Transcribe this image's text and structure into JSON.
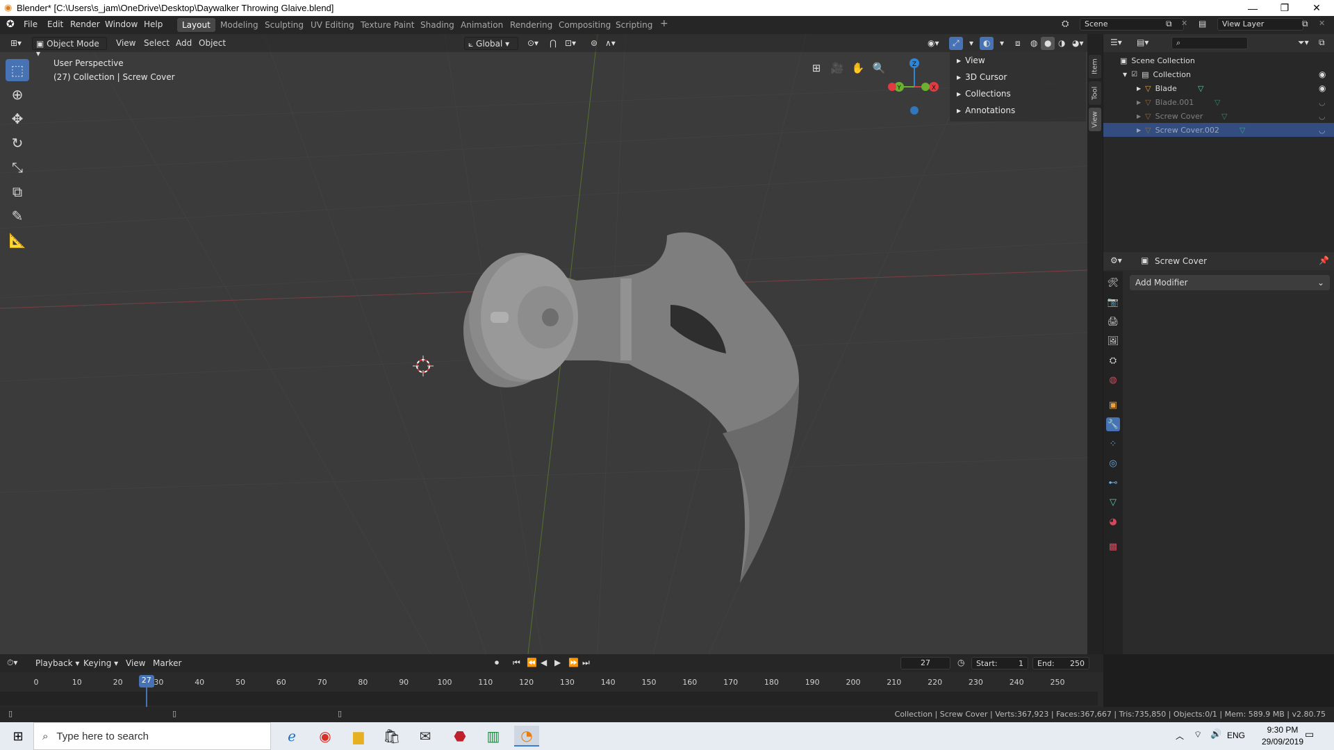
{
  "window": {
    "title": "Blender* [C:\\Users\\s_jam\\OneDrive\\Desktop\\Daywalker Throwing Glaive.blend]",
    "minimize": "—",
    "restore": "❐",
    "close": "✕"
  },
  "menu": [
    "File",
    "Edit",
    "Render",
    "Window",
    "Help"
  ],
  "workspaces": [
    {
      "label": "Layout",
      "active": true
    },
    {
      "label": "Modeling"
    },
    {
      "label": "Sculpting"
    },
    {
      "label": "UV Editing"
    },
    {
      "label": "Texture Paint"
    },
    {
      "label": "Shading"
    },
    {
      "label": "Animation"
    },
    {
      "label": "Rendering"
    },
    {
      "label": "Compositing"
    },
    {
      "label": "Scripting"
    }
  ],
  "add_workspace": "+",
  "scene": {
    "label": "Scene",
    "view_layer": "View Layer"
  },
  "viewport": {
    "mode": "Object Mode",
    "menus": [
      "View",
      "Select",
      "Add",
      "Object"
    ],
    "orientation": "Global",
    "perspective": "User Perspective",
    "collection_info": "(27) Collection | Screw Cover",
    "npanel_items": [
      "View",
      "3D Cursor",
      "Collections",
      "Annotations"
    ],
    "side_tabs": [
      "Item",
      "Tool",
      "View"
    ],
    "gizmo_axes": {
      "z": "Z",
      "y": "Y",
      "x": "X"
    }
  },
  "outliner": {
    "root": "Scene Collection",
    "collection": "Collection",
    "items": [
      {
        "name": "Blade",
        "hidden": false,
        "selected": false
      },
      {
        "name": "Blade.001",
        "hidden": true,
        "selected": false
      },
      {
        "name": "Screw Cover",
        "hidden": true,
        "selected": false
      },
      {
        "name": "Screw Cover.002",
        "hidden": true,
        "selected": true
      }
    ]
  },
  "properties": {
    "object_name": "Screw Cover",
    "add_modifier": "Add Modifier"
  },
  "timeline": {
    "menus": [
      "Playback",
      "Keying",
      "View",
      "Marker"
    ],
    "current_frame": "27",
    "start_label": "Start:",
    "start_value": "1",
    "end_label": "End:",
    "end_value": "250",
    "ticks": [
      "0",
      "10",
      "20",
      "30",
      "40",
      "50",
      "60",
      "70",
      "80",
      "90",
      "100",
      "110",
      "120",
      "130",
      "140",
      "150",
      "160",
      "170",
      "180",
      "190",
      "200",
      "210",
      "220",
      "230",
      "240",
      "250"
    ]
  },
  "statusbar": {
    "stats": "Collection | Screw Cover | Verts:367,923 | Faces:367,667 | Tris:735,850 | Objects:0/1 | Mem: 589.9 MB | v2.80.75"
  },
  "taskbar": {
    "search_placeholder": "Type here to search",
    "lang": "ENG",
    "time": "9:30 PM",
    "date": "29/09/2019"
  },
  "colors": {
    "accent": "#4772b3",
    "selected_row": "#334d80",
    "axis_x": "#e03b43",
    "axis_y": "#6bb02f",
    "axis_z": "#2e86d8"
  }
}
